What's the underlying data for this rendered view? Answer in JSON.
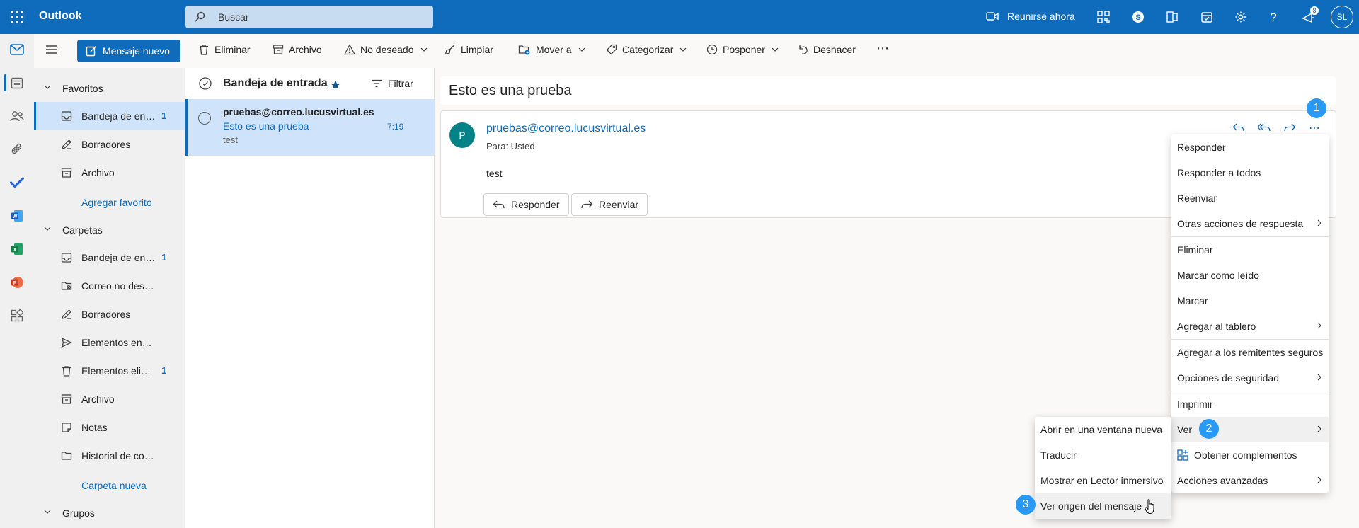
{
  "topbar": {
    "app_name": "Outlook",
    "search_placeholder": "Buscar",
    "meet_label": "Reunirse ahora",
    "notification_count": "8",
    "user_initials": "SL"
  },
  "command_bar": {
    "new_message": "Mensaje nuevo",
    "delete": "Eliminar",
    "archive": "Archivo",
    "junk": "No deseado",
    "sweep": "Limpiar",
    "move_to": "Mover a",
    "categorize": "Categorizar",
    "snooze": "Posponer",
    "undo": "Deshacer",
    "more": "⋯"
  },
  "folders": {
    "favorites_header": "Favoritos",
    "favorites": [
      {
        "label": "Bandeja de entrada",
        "count": "1"
      },
      {
        "label": "Borradores",
        "count": ""
      },
      {
        "label": "Archivo",
        "count": ""
      }
    ],
    "add_favorite": "Agregar favorito",
    "folders_header": "Carpetas",
    "folders": [
      {
        "label": "Bandeja de entrada",
        "count": "1"
      },
      {
        "label": "Correo no deseado",
        "count": ""
      },
      {
        "label": "Borradores",
        "count": ""
      },
      {
        "label": "Elementos enviados",
        "count": ""
      },
      {
        "label": "Elementos eliminados",
        "count": "1"
      },
      {
        "label": "Archivo",
        "count": ""
      },
      {
        "label": "Notas",
        "count": ""
      },
      {
        "label": "Historial de conversaciones",
        "count": ""
      }
    ],
    "new_folder": "Carpeta nueva",
    "groups_header": "Grupos"
  },
  "message_list": {
    "title": "Bandeja de entrada",
    "filter": "Filtrar",
    "items": [
      {
        "from": "pruebas@correo.lucusvirtual.es",
        "subject": "Esto es una prueba",
        "time": "7:19",
        "preview": "test"
      }
    ]
  },
  "reading_pane": {
    "subject": "Esto es una prueba",
    "sender_initial": "P",
    "sender": "pruebas@correo.lucusvirtual.es",
    "to": "Para:  Usted",
    "body": "test",
    "reply": "Responder",
    "forward": "Reenviar"
  },
  "context_menu": {
    "items": [
      {
        "label": "Responder"
      },
      {
        "label": "Responder a todos"
      },
      {
        "label": "Reenviar"
      },
      {
        "label": "Otras acciones de respuesta"
      },
      {
        "label": "Eliminar"
      },
      {
        "label": "Marcar como leído"
      },
      {
        "label": "Marcar"
      },
      {
        "label": "Agregar al tablero"
      },
      {
        "label": "Agregar a los remitentes seguros"
      },
      {
        "label": "Opciones de seguridad"
      },
      {
        "label": "Imprimir"
      },
      {
        "label": "Ver"
      },
      {
        "label": "Obtener complementos"
      },
      {
        "label": "Acciones avanzadas"
      }
    ]
  },
  "submenu": {
    "items": [
      {
        "label": "Abrir en una ventana nueva"
      },
      {
        "label": "Traducir"
      },
      {
        "label": "Mostrar en Lector inmersivo"
      },
      {
        "label": "Ver origen del mensaje"
      }
    ]
  },
  "step_badges": [
    "1",
    "2",
    "3"
  ],
  "colors": {
    "brand": "#0f6cbd",
    "selection": "#cfe4fa",
    "badge": "#2899f5",
    "avatar": "#038387"
  }
}
